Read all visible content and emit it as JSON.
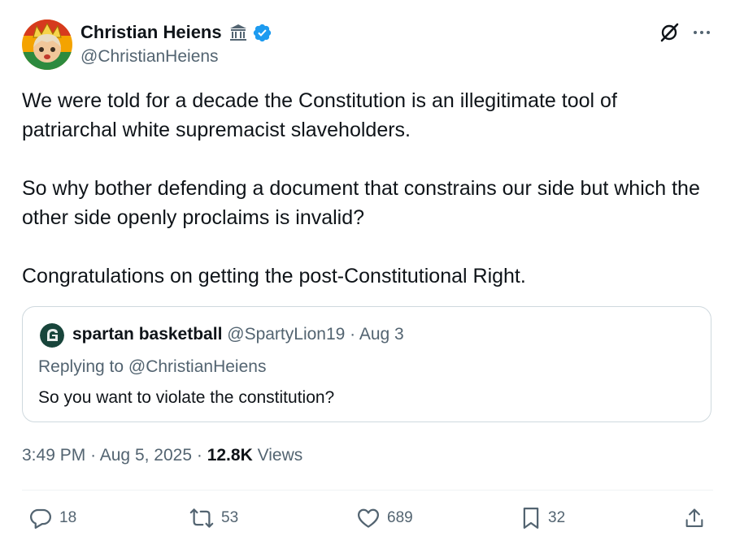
{
  "author": {
    "name": "Christian Heiens",
    "handle": "@ChristianHeiens",
    "name_icon": "classical-building-icon",
    "verified_icon": "verified-badge-icon",
    "avatar": "anime-avatar"
  },
  "tweet": {
    "paragraphs": [
      "We were told for a decade the Constitution is an illegitimate tool of patriarchal white supremacist slaveholders.",
      "So why bother defending a document that constrains our side but which the other side openly proclaims is invalid?",
      "Congratulations on getting the post-Constitutional Right."
    ]
  },
  "quote": {
    "name": "spartan basketball",
    "handle": "@SpartyLion19",
    "separator": "·",
    "date": "Aug 3",
    "replying": "Replying to @ChristianHeiens",
    "text": "So you want to violate the constitution?"
  },
  "meta": {
    "time": "3:49 PM",
    "dot": "·",
    "date": "Aug 5, 2025",
    "views_count": "12.8K",
    "views_label": "Views"
  },
  "actions": {
    "replies": "18",
    "reposts": "53",
    "likes": "689",
    "bookmarks": "32"
  },
  "colors": {
    "text": "#0f1419",
    "secondary": "#536471",
    "verified": "#1d9bf0",
    "border": "#cfd9de"
  }
}
